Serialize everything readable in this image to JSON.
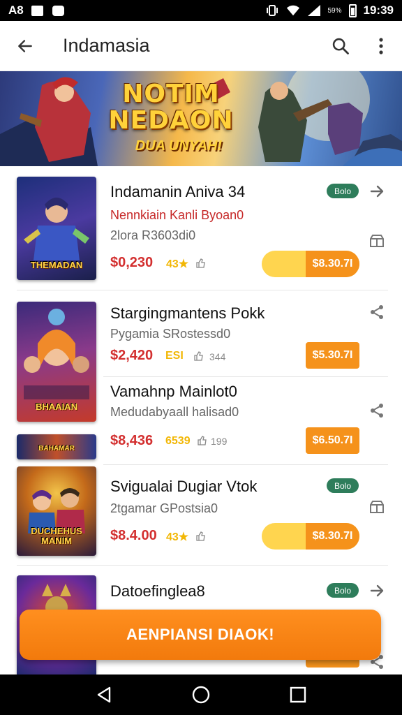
{
  "status_bar": {
    "left_text": "A8",
    "time": "19:39",
    "battery_pct": "59%",
    "icons": [
      "image-icon",
      "app-icon",
      "vibrate-icon",
      "wifi-icon",
      "signal-icon",
      "battery-icon"
    ]
  },
  "app_bar": {
    "title": "Indamasia",
    "icons": [
      "back-arrow-icon",
      "search-icon",
      "more-vert-icon"
    ]
  },
  "banner": {
    "title_line1": "NOTIM",
    "title_line2": "NEDAON",
    "subtitle": "DUA UNYAH!"
  },
  "items": [
    {
      "title": "Indamanin Aniva 34",
      "subtitle_red": "Nennkiain Kanli Byoan0",
      "subtitle": "2lora R3603di0",
      "price": "$0,230",
      "rating": "43★",
      "badge": "Bolo",
      "button": "$8.30.7I",
      "thumb_label": "THEMADAN"
    },
    {
      "title": "Stargingmantens Pokk",
      "subtitle": "Pygamia SRostessd0",
      "price": "$2,420",
      "rating": "ESI",
      "meta": "344",
      "button": "$5.30.7I",
      "thumb_label": "BHAAIAN"
    },
    {
      "title": "Vamahnp Mainlot0",
      "subtitle": "Medudabyaall halisad0",
      "price": "$8,436",
      "rating": "6539",
      "meta": "199",
      "button": "$6.50.7I",
      "thumb_label": "BAHAMAR"
    },
    {
      "title": "Svigualai Dugiar Vtok",
      "subtitle": "2tgamar GPostsia0",
      "price": "$8.4.00",
      "rating": "43★",
      "badge": "Bolo",
      "button": "$8.30.7I",
      "thumb_label": "DUCHEHUS MANIM"
    },
    {
      "title": "Datoefinglea8",
      "badge": "Bolo"
    }
  ],
  "cta": {
    "label": "AENPIANSI DIAOK!"
  },
  "nav_bar": {
    "icons": [
      "back-triangle-icon",
      "home-circle-icon",
      "recents-square-icon"
    ]
  }
}
